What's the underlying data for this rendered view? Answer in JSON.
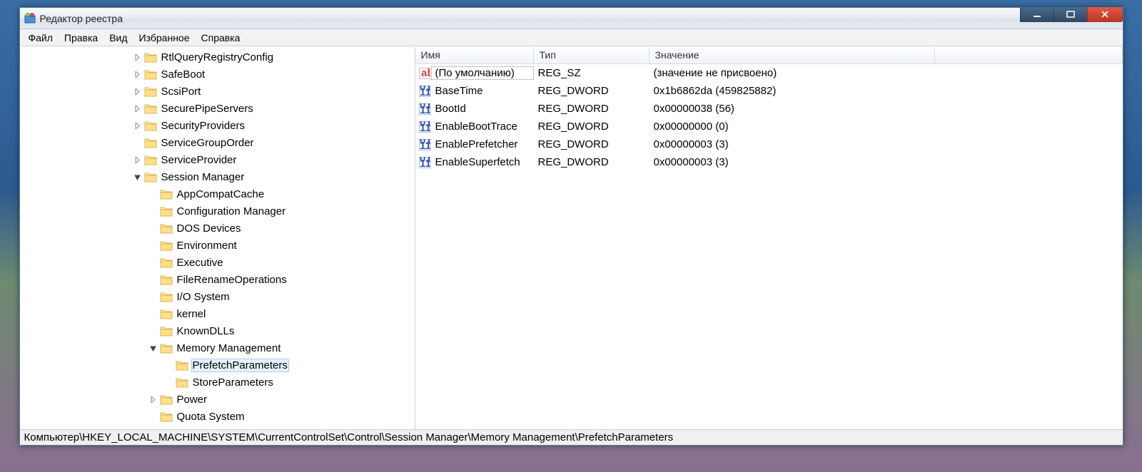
{
  "window": {
    "title": "Редактор реестра"
  },
  "menubar": {
    "items": [
      "Файл",
      "Правка",
      "Вид",
      "Избранное",
      "Справка"
    ]
  },
  "tree": {
    "nodes": [
      {
        "label": "RtlQueryRegistryConfig",
        "indent": 158,
        "expander": "closed"
      },
      {
        "label": "SafeBoot",
        "indent": 158,
        "expander": "closed"
      },
      {
        "label": "ScsiPort",
        "indent": 158,
        "expander": "closed"
      },
      {
        "label": "SecurePipeServers",
        "indent": 158,
        "expander": "closed"
      },
      {
        "label": "SecurityProviders",
        "indent": 158,
        "expander": "closed"
      },
      {
        "label": "ServiceGroupOrder",
        "indent": 158,
        "expander": "none"
      },
      {
        "label": "ServiceProvider",
        "indent": 158,
        "expander": "closed"
      },
      {
        "label": "Session Manager",
        "indent": 158,
        "expander": "open"
      },
      {
        "label": "AppCompatCache",
        "indent": 180,
        "expander": "none"
      },
      {
        "label": "Configuration Manager",
        "indent": 180,
        "expander": "none"
      },
      {
        "label": "DOS Devices",
        "indent": 180,
        "expander": "none"
      },
      {
        "label": "Environment",
        "indent": 180,
        "expander": "none"
      },
      {
        "label": "Executive",
        "indent": 180,
        "expander": "none"
      },
      {
        "label": "FileRenameOperations",
        "indent": 180,
        "expander": "none"
      },
      {
        "label": "I/O System",
        "indent": 180,
        "expander": "none"
      },
      {
        "label": "kernel",
        "indent": 180,
        "expander": "none"
      },
      {
        "label": "KnownDLLs",
        "indent": 180,
        "expander": "none"
      },
      {
        "label": "Memory Management",
        "indent": 180,
        "expander": "open"
      },
      {
        "label": "PrefetchParameters",
        "indent": 202,
        "expander": "none",
        "selected": true
      },
      {
        "label": "StoreParameters",
        "indent": 202,
        "expander": "none"
      },
      {
        "label": "Power",
        "indent": 180,
        "expander": "closed"
      },
      {
        "label": "Quota System",
        "indent": 180,
        "expander": "none"
      }
    ]
  },
  "list": {
    "columns": {
      "name": "Имя",
      "type": "Тип",
      "value": "Значение"
    },
    "rows": [
      {
        "icon": "sz",
        "name": "(По умолчанию)",
        "type": "REG_SZ",
        "value": "(значение не присвоено)",
        "default": true
      },
      {
        "icon": "dword",
        "name": "BaseTime",
        "type": "REG_DWORD",
        "value": "0x1b6862da (459825882)"
      },
      {
        "icon": "dword",
        "name": "BootId",
        "type": "REG_DWORD",
        "value": "0x00000038 (56)"
      },
      {
        "icon": "dword",
        "name": "EnableBootTrace",
        "type": "REG_DWORD",
        "value": "0x00000000 (0)"
      },
      {
        "icon": "dword",
        "name": "EnablePrefetcher",
        "type": "REG_DWORD",
        "value": "0x00000003 (3)"
      },
      {
        "icon": "dword",
        "name": "EnableSuperfetch",
        "type": "REG_DWORD",
        "value": "0x00000003 (3)"
      }
    ]
  },
  "statusbar": {
    "path": "Компьютер\\HKEY_LOCAL_MACHINE\\SYSTEM\\CurrentControlSet\\Control\\Session Manager\\Memory Management\\PrefetchParameters"
  }
}
